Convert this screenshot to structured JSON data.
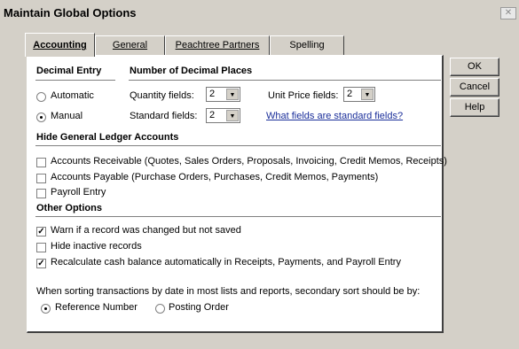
{
  "window": {
    "title": "Maintain Global Options",
    "close_glyph": "✕"
  },
  "tabs": [
    {
      "label": "Accounting",
      "active": true
    },
    {
      "label": "General",
      "active": false
    },
    {
      "label": "Peachtree Partners",
      "active": false
    },
    {
      "label": "Spelling",
      "active": false
    }
  ],
  "buttons": {
    "ok": "OK",
    "cancel": "Cancel",
    "help": "Help"
  },
  "decimal_entry": {
    "heading": "Decimal Entry",
    "automatic": {
      "label": "Automatic",
      "selected": false
    },
    "manual": {
      "label": "Manual",
      "selected": true
    }
  },
  "decimal_places": {
    "heading": "Number of Decimal Places",
    "quantity": {
      "label": "Quantity fields:",
      "value": "2"
    },
    "standard": {
      "label": "Standard fields:",
      "value": "2"
    },
    "unit_price": {
      "label": "Unit Price fields:",
      "value": "2"
    },
    "link": "What fields are standard fields?"
  },
  "hide_gl": {
    "heading": "Hide General Ledger Accounts",
    "items": [
      {
        "label": "Accounts Receivable (Quotes, Sales Orders, Proposals, Invoicing, Credit Memos, Receipts)",
        "checked": false
      },
      {
        "label": "Accounts Payable (Purchase Orders, Purchases, Credit Memos, Payments)",
        "checked": false
      },
      {
        "label": "Payroll Entry",
        "checked": false
      }
    ]
  },
  "other": {
    "heading": "Other Options",
    "items": [
      {
        "label": "Warn if a record was changed but not saved",
        "checked": true
      },
      {
        "label": "Hide inactive records",
        "checked": false
      },
      {
        "label": "Recalculate cash balance automatically in Receipts, Payments, and Payroll Entry",
        "checked": true
      }
    ]
  },
  "sorting": {
    "text": "When sorting transactions by date in most lists and reports, secondary sort should be by:",
    "reference": {
      "label": "Reference Number",
      "selected": true
    },
    "posting": {
      "label": "Posting Order",
      "selected": false
    }
  }
}
